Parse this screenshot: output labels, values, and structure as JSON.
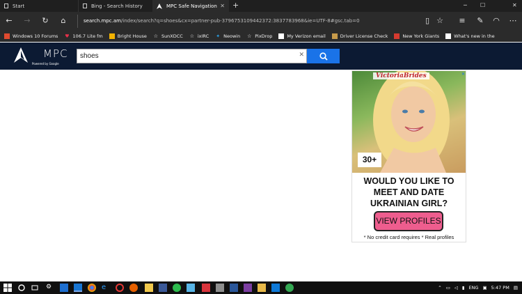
{
  "tabs": [
    {
      "label": "Start"
    },
    {
      "label": "Bing - Search History"
    },
    {
      "label": "MPC Safe Navigation"
    }
  ],
  "address_bar": {
    "host": "search.mpc.am",
    "rest": "/index/search?q=shoes&cx=partner-pub-3796753109442372:3837783968&ie=UTF-8#gsc.tab=0"
  },
  "favorites": [
    {
      "label": "Windows 10 Forums",
      "icon": "windows-flag",
      "color": "#e04a2f"
    },
    {
      "label": "106.7 Lite fm",
      "icon": "heart",
      "color": "#e8304a"
    },
    {
      "label": "Bright House",
      "icon": "bright-house",
      "color": "#f2b200"
    },
    {
      "label": "SunXDCC",
      "icon": "star",
      "color": "#dddddd"
    },
    {
      "label": "ixIRC",
      "icon": "star",
      "color": "#dddddd"
    },
    {
      "label": "Neowin",
      "icon": "neowin",
      "color": "#2aa3ea"
    },
    {
      "label": "PixDrop",
      "icon": "star",
      "color": "#dddddd"
    },
    {
      "label": "My Verizon email",
      "icon": "page",
      "color": "#ffffff"
    },
    {
      "label": "Driver License Check",
      "icon": "dl",
      "color": "#c69a4a"
    },
    {
      "label": "New York Giants",
      "icon": "ny",
      "color": "#d63a2f"
    },
    {
      "label": "What's new in the",
      "icon": "page",
      "color": "#ffffff"
    }
  ],
  "page": {
    "logo": {
      "brand": "MPC",
      "sub": "Powered by Google"
    },
    "search": {
      "value": "shoes"
    }
  },
  "ad": {
    "brand": "VictoriaBrides",
    "age_badge": "30+",
    "headline": "WOULD YOU LIKE TO MEET AND DATE UKRAINIAN GIRL?",
    "cta": "VIEW PROFILES",
    "footer": "* No credit card requires   * Real profiles"
  },
  "taskbar": {
    "lang": "ENG",
    "time": "5:47 PM"
  }
}
